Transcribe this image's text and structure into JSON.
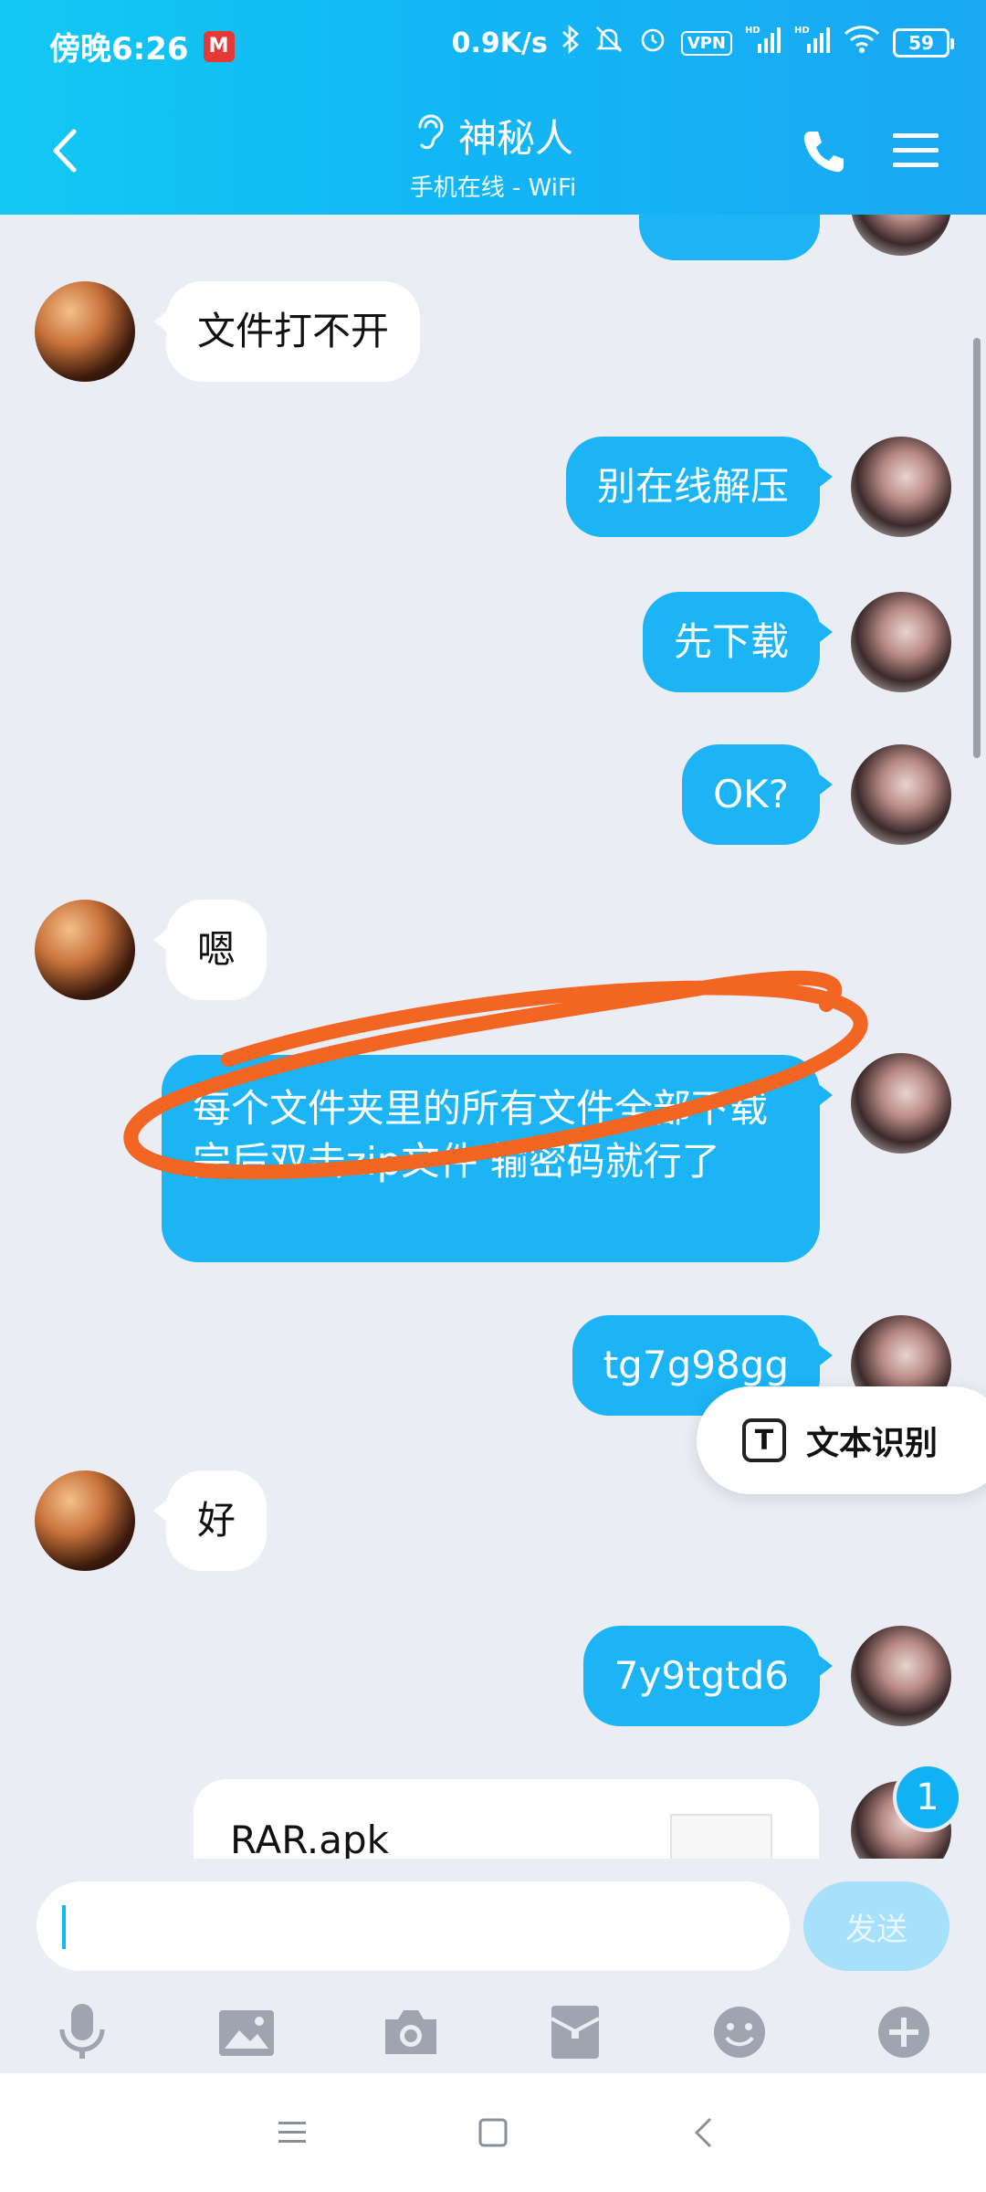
{
  "status_bar": {
    "time": "傍晚6:26",
    "app_badge": "M",
    "network_speed": "0.9K/s",
    "vpn_label": "VPN",
    "hd1": "HD",
    "hd2": "HD",
    "battery": "59"
  },
  "header": {
    "title": "神秘人",
    "subtitle": "手机在线 - WiFi"
  },
  "messages": [
    {
      "side": "in",
      "text": "文件打不开"
    },
    {
      "side": "out",
      "text": "别在线解压"
    },
    {
      "side": "out",
      "text": "先下载"
    },
    {
      "side": "out",
      "text": "OK?"
    },
    {
      "side": "in",
      "text": "嗯"
    },
    {
      "side": "out",
      "text": "每个文件夹里的所有文件全部下载完后双击zip文件 输密码就行了"
    },
    {
      "side": "out",
      "text": "tg7g98gg"
    },
    {
      "side": "in",
      "text": "好"
    },
    {
      "side": "out",
      "text": "7y9tgtd6"
    }
  ],
  "file_card": {
    "name": "RAR.apk"
  },
  "ocr_popup": {
    "icon_letter": "T",
    "label": "文本识别"
  },
  "unread_badge": "1",
  "input": {
    "value": "",
    "send_label": "发送"
  },
  "toolbar_icons": [
    "microphone-icon",
    "image-icon",
    "camera-icon",
    "red-packet-icon",
    "emoji-icon",
    "plus-icon"
  ],
  "colors": {
    "header_bg": "#12b7f5",
    "outgoing_bubble": "#1cb4f5",
    "incoming_bubble": "#ffffff",
    "chat_bg": "#ebedf5",
    "annotation_stroke": "#f26522"
  }
}
